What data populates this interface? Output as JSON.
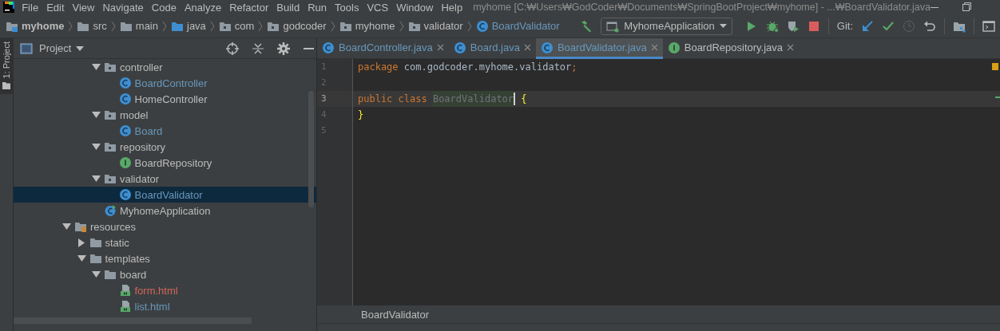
{
  "menu_bar": {
    "items": [
      {
        "label": "File"
      },
      {
        "label": "Edit"
      },
      {
        "label": "View"
      },
      {
        "label": "Navigate"
      },
      {
        "label": "Code"
      },
      {
        "label": "Analyze"
      },
      {
        "label": "Refactor"
      },
      {
        "label": "Build"
      },
      {
        "label": "Run"
      },
      {
        "label": "Tools"
      },
      {
        "label": "VCS"
      },
      {
        "label": "Window"
      },
      {
        "label": "Help"
      }
    ],
    "title": "myhome [C:₩Users₩GodCoder₩Documents₩SpringBootProject₩myhome] - ...₩BoardValidator.java"
  },
  "navigation_bar": {
    "crumbs": [
      {
        "label": "myhome",
        "kind": "project"
      },
      {
        "label": "src",
        "kind": "folder"
      },
      {
        "label": "main",
        "kind": "folder"
      },
      {
        "label": "java",
        "kind": "source"
      },
      {
        "label": "com",
        "kind": "package"
      },
      {
        "label": "godcoder",
        "kind": "package"
      },
      {
        "label": "myhome",
        "kind": "package"
      },
      {
        "label": "validator",
        "kind": "package"
      },
      {
        "label": "BoardValidator",
        "kind": "class"
      }
    ],
    "run_configuration": "MyhomeApplication",
    "vcs_label": "Git:"
  },
  "tool_strip": {
    "label": "1: Project"
  },
  "project_panel": {
    "title": "Project",
    "tree": [
      {
        "children": [
          {
            "children": [
              {
                "label": "controller",
                "kind": "package",
                "expanded": true,
                "selected": false,
                "children": [
                  {
                    "label": "BoardController",
                    "kind": "class",
                    "color": "#6897bb",
                    "selected": false
                  },
                  {
                    "label": "HomeController",
                    "kind": "class",
                    "color": "#bbbbbb",
                    "selected": false
                  }
                ]
              },
              {
                "label": "model",
                "kind": "package",
                "expanded": true,
                "selected": false,
                "children": [
                  {
                    "label": "Board",
                    "kind": "class",
                    "color": "#6897bb",
                    "selected": false
                  }
                ]
              },
              {
                "label": "repository",
                "kind": "package",
                "expanded": true,
                "selected": false,
                "children": [
                  {
                    "label": "BoardRepository",
                    "kind": "interface",
                    "color": "#bbbbbb",
                    "selected": false
                  }
                ]
              },
              {
                "label": "validator",
                "kind": "package",
                "expanded": true,
                "selected": false,
                "children": [
                  {
                    "label": "BoardValidator",
                    "kind": "class",
                    "color": "#6897bb",
                    "selected": true
                  }
                ]
              },
              {
                "label": "MyhomeApplication",
                "kind": "application",
                "color": "#bbbbbb",
                "selected": false
              }
            ]
          }
        ]
      },
      {
        "label": "resources",
        "kind": "resources",
        "expanded": true,
        "selected": false,
        "children": [
          {
            "label": "static",
            "kind": "folder",
            "expanded": false,
            "selected": false
          },
          {
            "label": "templates",
            "kind": "folder",
            "expanded": true,
            "selected": false,
            "children": [
              {
                "label": "board",
                "kind": "folder",
                "expanded": true,
                "selected": false,
                "children": [
                  {
                    "label": "form.html",
                    "kind": "html",
                    "color": "#d1675a",
                    "selected": false
                  },
                  {
                    "label": "list.html",
                    "kind": "html",
                    "color": "#6897bb",
                    "selected": false
                  }
                ]
              }
            ]
          }
        ]
      }
    ]
  },
  "tabs": [
    {
      "label": "BoardController.java",
      "kind": "class",
      "color": "#6897bb",
      "selected": false
    },
    {
      "label": "Board.java",
      "kind": "class",
      "color": "#6897bb",
      "selected": false
    },
    {
      "label": "BoardValidator.java",
      "kind": "class",
      "color": "#6897bb",
      "selected": true
    },
    {
      "label": "BoardRepository.java",
      "kind": "interface",
      "color": "#bbbbbb",
      "selected": false
    }
  ],
  "editor": {
    "lines": [
      {
        "number": "1",
        "current": false,
        "tokens": [
          {
            "text": "package",
            "kind": "keyword"
          },
          {
            "text": "com.godcoder.myhome.validator",
            "kind": "plain",
            "spaced": true
          },
          {
            "text": ";",
            "kind": "keyword"
          }
        ]
      },
      {
        "number": "2",
        "current": false
      },
      {
        "number": "3",
        "current": true,
        "tokens": [
          {
            "text": "public",
            "kind": "keyword"
          },
          {
            "text": "class",
            "kind": "keyword",
            "spaced": true
          },
          {
            "text": "BoardValidator",
            "kind": "unused",
            "spaced": true
          },
          {
            "kind": "caret"
          },
          {
            "text": "{",
            "kind": "brace",
            "spaced": true
          }
        ]
      },
      {
        "number": "4",
        "current": false,
        "tokens": [
          {
            "text": "}",
            "kind": "brace"
          }
        ]
      },
      {
        "number": "5",
        "current": false
      }
    ],
    "breadcrumb": "BoardValidator"
  }
}
